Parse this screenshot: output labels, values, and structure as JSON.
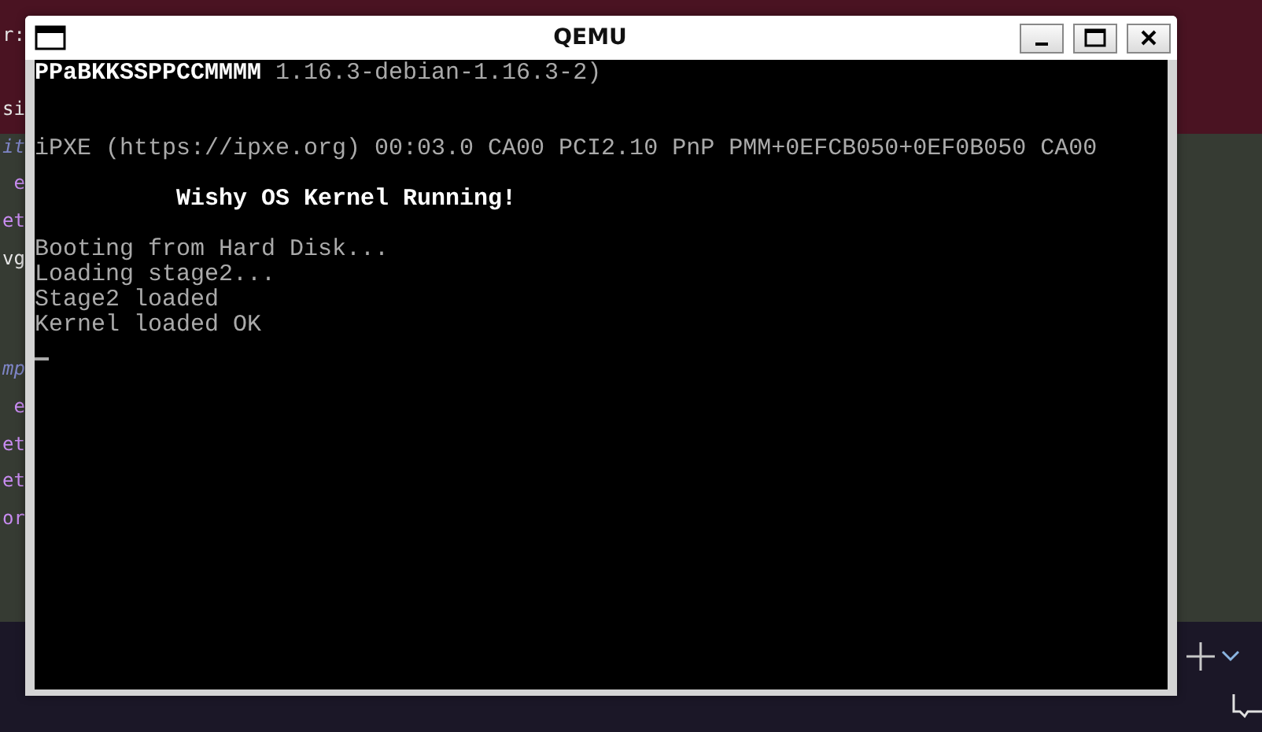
{
  "editor": {
    "lines": [
      {
        "kind": "plain",
        "text": "r:"
      },
      {
        "kind": "blank"
      },
      {
        "kind": "plain",
        "text": "si"
      },
      {
        "kind": "comment",
        "text": "it"
      },
      {
        "kind": "keyword",
        "text": "e"
      },
      {
        "kind": "keyword",
        "text": "et"
      },
      {
        "kind": "plain",
        "text": "vg"
      },
      {
        "kind": "blank"
      },
      {
        "kind": "blank"
      },
      {
        "kind": "comment",
        "text": "mp"
      },
      {
        "kind": "keyword",
        "text": "e"
      },
      {
        "kind": "keyword",
        "text": "et"
      },
      {
        "kind": "keyword",
        "text": "et"
      },
      {
        "kind": "keyword",
        "text": "or"
      }
    ]
  },
  "window": {
    "title": "QEMU",
    "console": [
      {
        "kind": "text",
        "segments": [
          {
            "text": "PPaBKKSSPPCCMMMM",
            "bright": true
          },
          {
            "text": " 1.16.3-debian-1.16.3-2)",
            "bright": false
          }
        ]
      },
      {
        "kind": "blank"
      },
      {
        "kind": "blank"
      },
      {
        "kind": "text",
        "segments": [
          {
            "text": "iPXE (https://ipxe.org) 00:03.0 CA00 PCI2.10 PnP PMM+0EFCB050+0EF0B050 CA00",
            "bright": false
          }
        ]
      },
      {
        "kind": "blank"
      },
      {
        "kind": "text",
        "segments": [
          {
            "text": "          Wishy OS Kernel Running!",
            "bright": true
          }
        ]
      },
      {
        "kind": "blank"
      },
      {
        "kind": "text",
        "segments": [
          {
            "text": "Booting from Hard Disk...",
            "bright": false
          }
        ]
      },
      {
        "kind": "text",
        "segments": [
          {
            "text": "Loading stage2...",
            "bright": false
          }
        ]
      },
      {
        "kind": "text",
        "segments": [
          {
            "text": "Stage2 loaded",
            "bright": false
          }
        ]
      },
      {
        "kind": "text",
        "segments": [
          {
            "text": "Kernel loaded OK",
            "bright": false
          }
        ]
      },
      {
        "kind": "cursor"
      }
    ]
  }
}
